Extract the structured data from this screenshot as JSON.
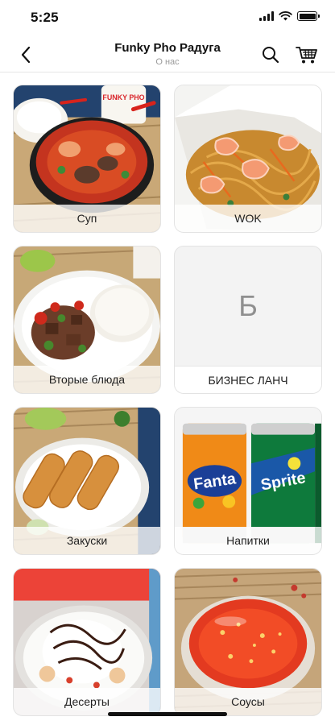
{
  "status_bar": {
    "time": "5:25"
  },
  "nav": {
    "title": "Funky Pho Радуга",
    "subtitle": "О нас"
  },
  "icons": {
    "back": "chevron-left-icon",
    "search": "search-icon",
    "cart": "cart-icon",
    "wifi": "wifi-icon",
    "battery": "battery-icon"
  },
  "categories": [
    {
      "label": "Суп"
    },
    {
      "label": "WOK"
    },
    {
      "label": "Вторые блюда"
    },
    {
      "label": "БИЗНЕС ЛАНЧ",
      "placeholder_letter": "Б"
    },
    {
      "label": "Закуски"
    },
    {
      "label": "Напитки"
    },
    {
      "label": "Десерты"
    },
    {
      "label": "Соусы"
    }
  ],
  "photo_texts": {
    "brand_cup": "FUNKY PHO",
    "can_1": "Fanta",
    "can_2": "Sprite"
  }
}
